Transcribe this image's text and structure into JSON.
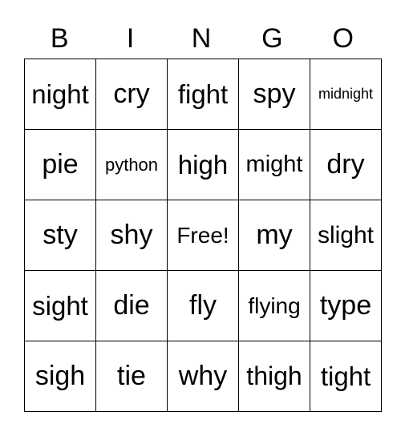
{
  "header": [
    "B",
    "I",
    "N",
    "G",
    "O"
  ],
  "rows": [
    [
      "night",
      "cry",
      "fight",
      "spy",
      "midnight"
    ],
    [
      "pie",
      "python",
      "high",
      "might",
      "dry"
    ],
    [
      "sty",
      "shy",
      "Free!",
      "my",
      "slight"
    ],
    [
      "sight",
      "die",
      "fly",
      "flying",
      "type"
    ],
    [
      "sigh",
      "tie",
      "why",
      "thigh",
      "tight"
    ]
  ]
}
